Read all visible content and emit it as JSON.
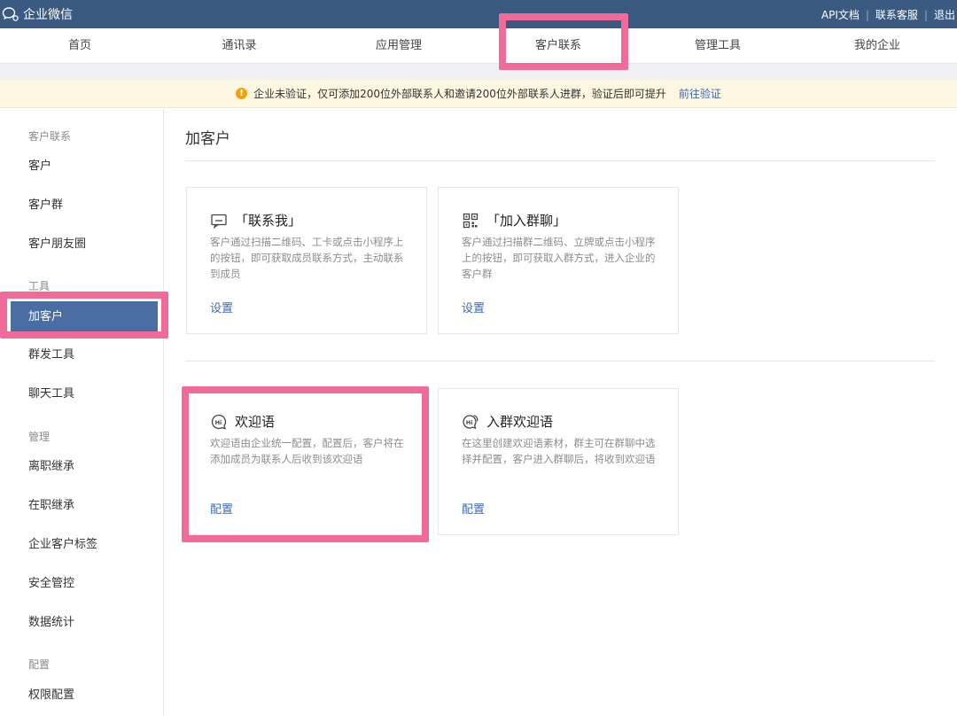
{
  "app": {
    "title": "企业微信"
  },
  "top_links": [
    "API文档",
    "联系客服",
    "退出"
  ],
  "nav": {
    "items": [
      "首页",
      "通讯录",
      "应用管理",
      "客户联系",
      "管理工具",
      "我的企业"
    ]
  },
  "notice": {
    "text": "企业未验证，仅可添加200位外部联系人和邀请200位外部联系人进群，验证后即可提升",
    "link": "前往验证"
  },
  "sidebar": {
    "groups": {
      "customer": "客户联系",
      "tools": "工具",
      "manage": "管理",
      "config": "配置"
    },
    "items": {
      "customers": "客户",
      "customer_groups": "客户群",
      "moments": "客户朋友圈",
      "add_customer": "加客户",
      "mass_send": "群发工具",
      "chat_tools": "聊天工具",
      "resign_transfer": "离职继承",
      "onjob_transfer": "在职继承",
      "tags": "企业客户标签",
      "security": "安全管控",
      "stats": "数据统计",
      "permissions": "权限配置"
    },
    "active": "add_customer"
  },
  "main": {
    "title": "加客户",
    "cards": {
      "contact_me": {
        "title": "「联系我」",
        "desc": "客户通过扫描二维码、工卡或点击小程序上的按钮，即可获取成员联系方式，主动联系到成员",
        "link": "设置",
        "icon": "chat-bubble-icon"
      },
      "join_group": {
        "title": "「加入群聊」",
        "desc": "客户通过扫描群二维码、立牌或点击小程序上的按钮，即可获取入群方式，进入企业的客户群",
        "link": "设置",
        "icon": "qr-code-icon"
      },
      "welcome": {
        "title": "欢迎语",
        "desc": "欢迎语由企业统一配置，配置后，客户将在添加成员为联系人后收到该欢迎语",
        "link": "配置",
        "icon": "hi-bubble-icon"
      },
      "group_welcome": {
        "title": "入群欢迎语",
        "desc": "在这里创建欢迎语素材，群主可在群聊中选择并配置，客户进入群聊后，将收到欢迎语",
        "link": "配置",
        "icon": "hi-group-bubble-icon"
      }
    }
  },
  "colors": {
    "topbar": "#3b5a82",
    "active_side": "#4a6ea3",
    "link": "#3b6bb8",
    "highlight": "#f06a9a",
    "notice_bg": "#fdf6e0"
  }
}
